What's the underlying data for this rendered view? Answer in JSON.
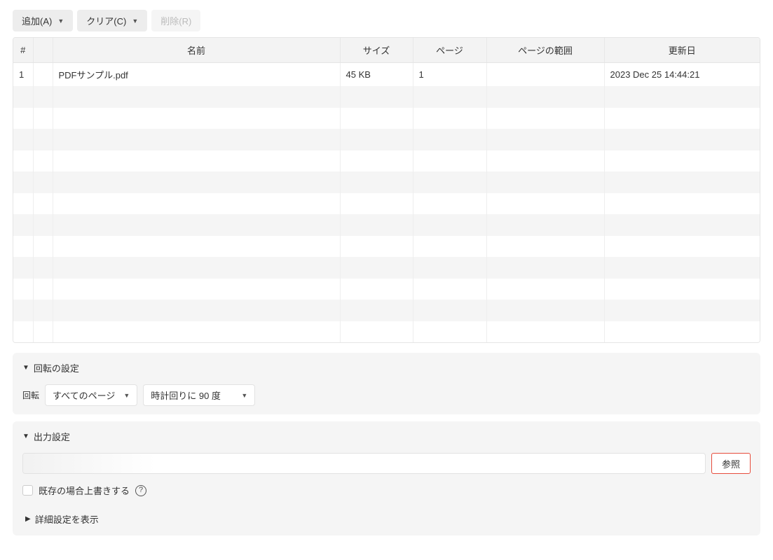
{
  "toolbar": {
    "add_label": "追加(A)",
    "clear_label": "クリア(C)",
    "remove_label": "削除(R)"
  },
  "table": {
    "headers": {
      "num": "#",
      "name": "名前",
      "size": "サイズ",
      "page": "ページ",
      "range": "ページの範囲",
      "date": "更新日"
    },
    "rows": [
      {
        "num": "1",
        "name": "PDFサンプル.pdf",
        "size": "45 KB",
        "page": "1",
        "range": "",
        "date": "2023 Dec 25 14:44:21"
      },
      {
        "num": "",
        "name": "",
        "size": "",
        "page": "",
        "range": "",
        "date": ""
      },
      {
        "num": "",
        "name": "",
        "size": "",
        "page": "",
        "range": "",
        "date": ""
      },
      {
        "num": "",
        "name": "",
        "size": "",
        "page": "",
        "range": "",
        "date": ""
      },
      {
        "num": "",
        "name": "",
        "size": "",
        "page": "",
        "range": "",
        "date": ""
      },
      {
        "num": "",
        "name": "",
        "size": "",
        "page": "",
        "range": "",
        "date": ""
      },
      {
        "num": "",
        "name": "",
        "size": "",
        "page": "",
        "range": "",
        "date": ""
      },
      {
        "num": "",
        "name": "",
        "size": "",
        "page": "",
        "range": "",
        "date": ""
      },
      {
        "num": "",
        "name": "",
        "size": "",
        "page": "",
        "range": "",
        "date": ""
      },
      {
        "num": "",
        "name": "",
        "size": "",
        "page": "",
        "range": "",
        "date": ""
      },
      {
        "num": "",
        "name": "",
        "size": "",
        "page": "",
        "range": "",
        "date": ""
      },
      {
        "num": "",
        "name": "",
        "size": "",
        "page": "",
        "range": "",
        "date": ""
      },
      {
        "num": "",
        "name": "",
        "size": "",
        "page": "",
        "range": "",
        "date": ""
      }
    ]
  },
  "rotate_panel": {
    "title": "回転の設定",
    "label": "回転",
    "pages_value": "すべてのページ",
    "angle_value": "時計回りに 90 度"
  },
  "output_panel": {
    "title": "出力設定",
    "path_value": "",
    "browse_label": "参照",
    "overwrite_label": "既存の場合上書きする",
    "advanced_label": "詳細設定を表示"
  }
}
